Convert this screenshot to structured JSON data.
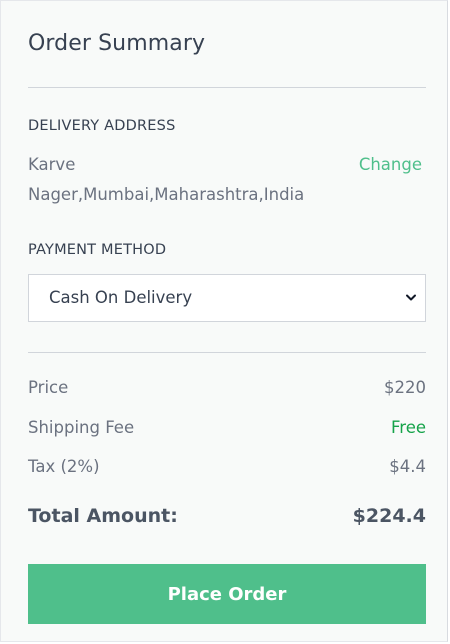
{
  "summary": {
    "title": "Order Summary"
  },
  "delivery": {
    "label": "DELIVERY ADDRESS",
    "address_line1": "Karve",
    "address_line2": "Nager,Mumbai,Maharashtra,India",
    "change_label": "Change"
  },
  "payment": {
    "label": "PAYMENT METHOD",
    "selected": "Cash On Delivery"
  },
  "totals": {
    "price_label": "Price",
    "price_value": "$220",
    "shipping_label": "Shipping Fee",
    "shipping_value": "Free",
    "tax_label": "Tax (2%)",
    "tax_value": "$4.4",
    "total_label": "Total Amount:",
    "total_value": "$224.4"
  },
  "actions": {
    "place_order_label": "Place Order"
  },
  "colors": {
    "accent": "#4fbf8b",
    "free": "#16a34a",
    "text": "#374151",
    "muted": "#6b7280"
  },
  "icons": {
    "select_chevron": "chevron-down-icon"
  }
}
